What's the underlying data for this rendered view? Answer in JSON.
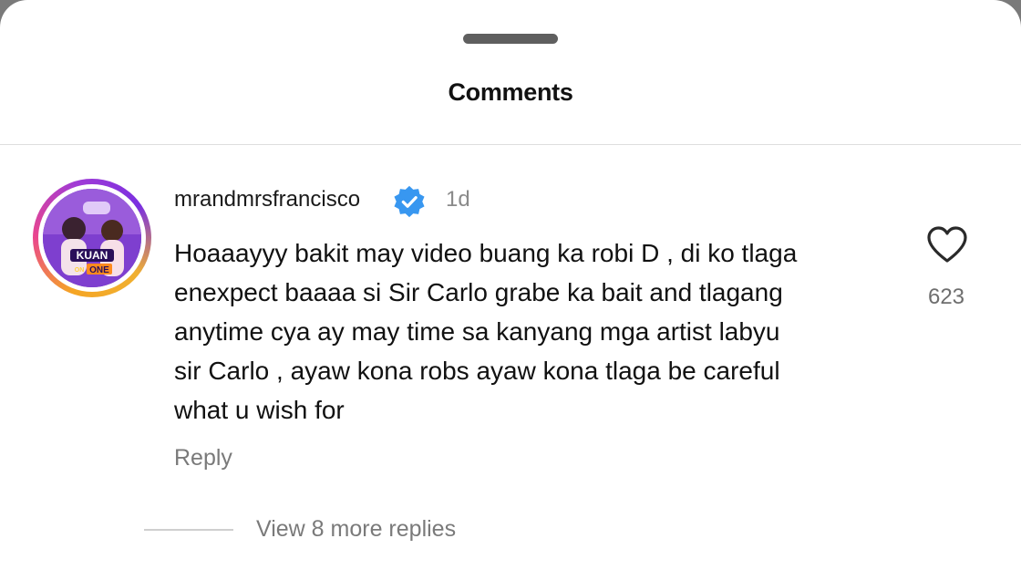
{
  "sheet": {
    "title": "Comments"
  },
  "comment": {
    "username": "mrandmrsfrancisco",
    "verified": true,
    "time": "1d",
    "text_lines": [
      "Hoaaayyy bakit may video buang ka robi D , di ko tlaga",
      "enexpect baaaa si Sir Carlo grabe ka bait and tlagang",
      "anytime cya ay may time sa kanyang mga artist labyu",
      "sir Carlo , ayaw kona robs ayaw kona tlaga be careful",
      "what u wish for"
    ],
    "like_count": "623",
    "reply_label": "Reply",
    "avatar_logo_text": [
      "KUAN",
      "ON",
      "ONE"
    ]
  },
  "replies": {
    "view_more_label": "View 8 more replies"
  },
  "colors": {
    "verified_blue": "#3897f0",
    "ring_orange": "#f5a524",
    "ring_purple": "#a03bd6",
    "muted_text": "#7a7a7a"
  }
}
